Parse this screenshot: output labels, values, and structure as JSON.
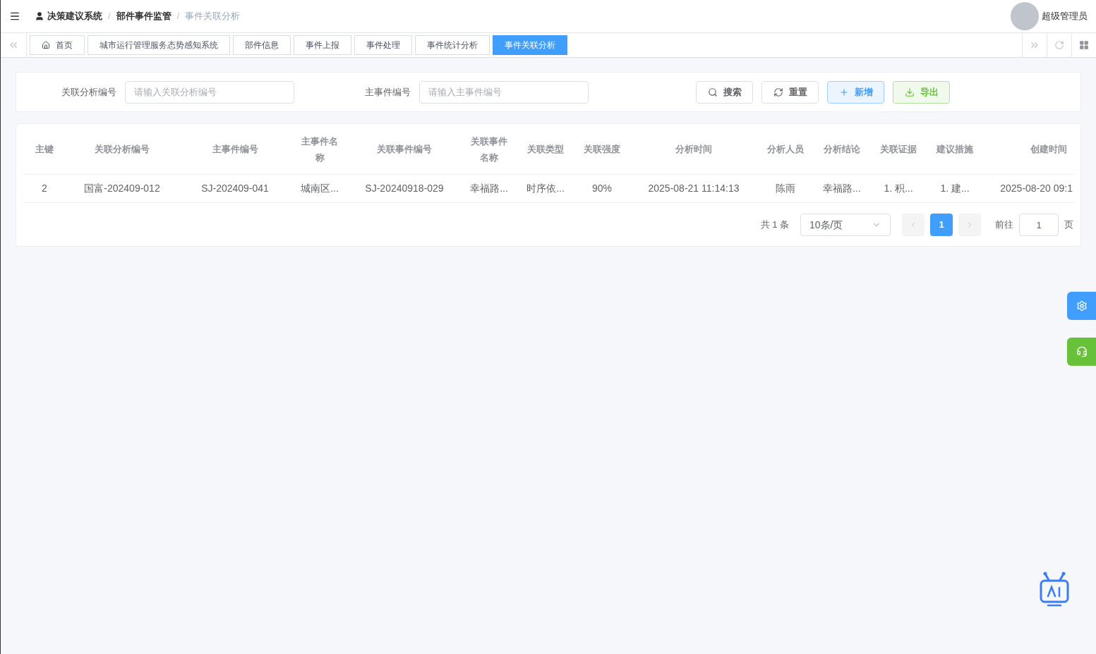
{
  "breadcrumb": [
    {
      "label": "决策建议系统",
      "selected": false
    },
    {
      "label": "部件事件监管",
      "selected": false
    },
    {
      "label": "事件关联分析",
      "selected": true
    }
  ],
  "breadcrumb_separator": "/",
  "user": {
    "name": "超级管理员"
  },
  "tabs": [
    {
      "label": "首页",
      "selected": false,
      "kind": "home"
    },
    {
      "label": "城市运行管理服务态势感知系统",
      "selected": false,
      "kind": "plain"
    },
    {
      "label": "部件信息",
      "selected": false,
      "kind": "plain"
    },
    {
      "label": "事件上报",
      "selected": false,
      "kind": "plain"
    },
    {
      "label": "事件处理",
      "selected": false,
      "kind": "plain"
    },
    {
      "label": "事件统计分析",
      "selected": false,
      "kind": "plain"
    },
    {
      "label": "事件关联分析",
      "selected": true,
      "kind": "plain"
    }
  ],
  "filters": [
    {
      "label": "关联分析编号",
      "placeholder": "请输入关联分析编号"
    },
    {
      "label": "主事件编号",
      "placeholder": "请输入主事件编号"
    }
  ],
  "actions": [
    {
      "label": "搜索",
      "kind": "search"
    },
    {
      "label": "重置",
      "kind": "reset"
    },
    {
      "label": "新增",
      "kind": "add"
    },
    {
      "label": "导出",
      "kind": "export"
    }
  ],
  "table": {
    "columns": [
      "主键",
      "关联分析编号",
      "主事件编号",
      "主事件名称",
      "关联事件编号",
      "关联事件名称",
      "关联类型",
      "关联强度",
      "分析时间",
      "分析人员",
      "分析结论",
      "关联证据",
      "建议措施",
      "创建时间"
    ],
    "rows": [
      [
        "2",
        "国富-202409-012",
        "SJ-202409-041",
        "城南区...",
        "SJ-20240918-029",
        "幸福路...",
        "时序依...",
        "90%",
        "2025-08-21 11:14:13",
        "陈雨",
        "幸福路...",
        "1. 积...",
        "1. 建...",
        "2025-08-20 09:1"
      ]
    ]
  },
  "pagination": {
    "total": "共 1 条",
    "page_size": "10条/页",
    "pages": [
      {
        "label": "1",
        "selected": true
      }
    ],
    "goto_label": "前往",
    "goto_value": "1",
    "page_suffix": "页"
  }
}
